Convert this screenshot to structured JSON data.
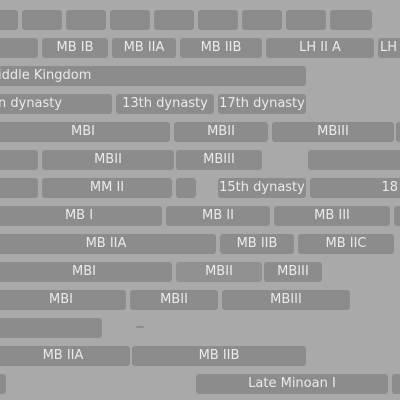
{
  "rows": [
    {
      "name": "row-01",
      "cells": [
        {
          "label": ""
        },
        {
          "label": ""
        },
        {
          "label": ""
        },
        {
          "label": ""
        },
        {
          "label": ""
        },
        {
          "label": ""
        },
        {
          "label": ""
        },
        {
          "label": ""
        }
      ]
    },
    {
      "name": "row-02",
      "cells": [
        {
          "label": ""
        },
        {
          "label": "MB IB"
        },
        {
          "label": "MB IIA"
        },
        {
          "label": "MB IIB"
        },
        {
          "label": "LH II A"
        },
        {
          "label": "LH"
        }
      ]
    },
    {
      "name": "row-03",
      "cells": [
        {
          "label": "iddle Kingdom"
        }
      ]
    },
    {
      "name": "row-04",
      "cells": [
        {
          "label": "n dynasty"
        },
        {
          "label": "13th dynasty"
        },
        {
          "label": "17th dynasty"
        }
      ]
    },
    {
      "name": "row-05",
      "cells": [
        {
          "label": "MBI"
        },
        {
          "label": "MBII"
        },
        {
          "label": "MBIII"
        },
        {
          "label": ""
        }
      ]
    },
    {
      "name": "row-06",
      "cells": [
        {
          "label": ""
        },
        {
          "label": "MBII"
        },
        {
          "label": "MBIII"
        },
        {
          "label": ""
        }
      ]
    },
    {
      "name": "row-07",
      "cells": [
        {
          "label": ""
        },
        {
          "label": "MM II"
        },
        {
          "label": ""
        },
        {
          "label": "15th dynasty"
        },
        {
          "label": "18"
        }
      ]
    },
    {
      "name": "row-08",
      "cells": [
        {
          "label": "MB I"
        },
        {
          "label": "MB II"
        },
        {
          "label": "MB III"
        },
        {
          "label": ""
        }
      ]
    },
    {
      "name": "row-09",
      "cells": [
        {
          "label": "MB IIA"
        },
        {
          "label": "MB IIB"
        },
        {
          "label": "MB IIC"
        }
      ]
    },
    {
      "name": "row-10",
      "cells": [
        {
          "label": "MBI"
        },
        {
          "label": "MBII"
        },
        {
          "label": "MBIII"
        }
      ]
    },
    {
      "name": "row-11",
      "cells": [
        {
          "label": "MBI"
        },
        {
          "label": "MBII"
        },
        {
          "label": "MBIII"
        }
      ]
    },
    {
      "name": "row-12",
      "cells": [
        {
          "label": ""
        }
      ]
    },
    {
      "name": "row-13",
      "cells": [
        {
          "label": "MB IIA"
        },
        {
          "label": "MB IIB"
        }
      ]
    },
    {
      "name": "row-14",
      "cells": [
        {
          "label": ""
        },
        {
          "label": "Late Minoan I"
        },
        {
          "label": ""
        }
      ]
    }
  ]
}
